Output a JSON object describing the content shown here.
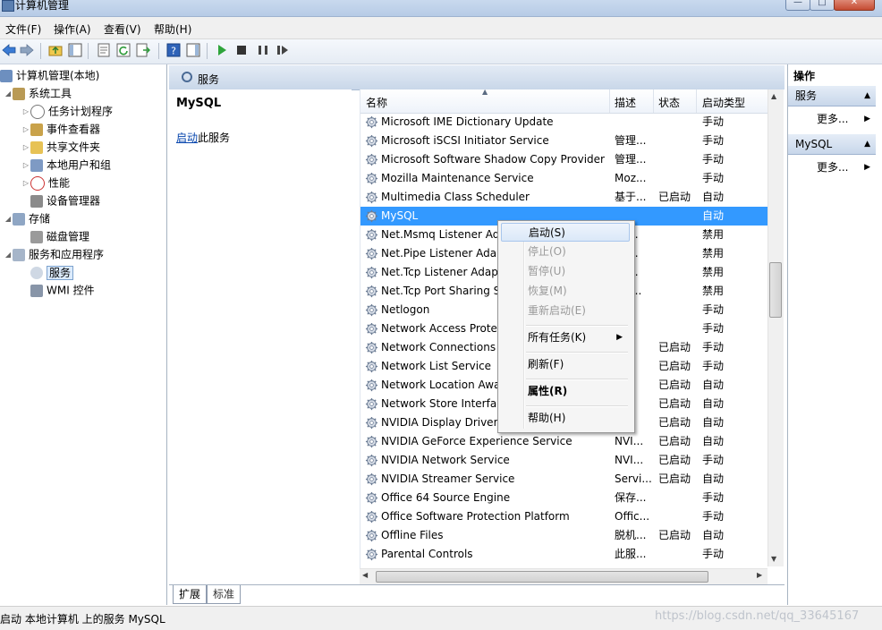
{
  "window": {
    "title": "计算机管理"
  },
  "menu": {
    "items": [
      "文件(F)",
      "操作(A)",
      "查看(V)",
      "帮助(H)"
    ]
  },
  "tree": {
    "root": "计算机管理(本地)",
    "system_tools": "系统工具",
    "task_scheduler": "任务计划程序",
    "event_viewer": "事件查看器",
    "shared_folders": "共享文件夹",
    "local_users": "本地用户和组",
    "performance": "性能",
    "device_manager": "设备管理器",
    "storage": "存储",
    "disk_management": "磁盘管理",
    "services_apps": "服务和应用程序",
    "services": "服务",
    "wmi": "WMI 控件"
  },
  "center": {
    "header_title": "服务",
    "selected_service": "MySQL",
    "start_link": "启动",
    "start_suffix": "此服务"
  },
  "columns": {
    "name": "名称",
    "desc": "描述",
    "status": "状态",
    "startup": "启动类型"
  },
  "services": [
    {
      "name": "Microsoft IME Dictionary Update",
      "desc": "",
      "status": "",
      "startup": "手动"
    },
    {
      "name": "Microsoft iSCSI Initiator Service",
      "desc": "管理...",
      "status": "",
      "startup": "手动"
    },
    {
      "name": "Microsoft Software Shadow Copy Provider",
      "desc": "管理...",
      "status": "",
      "startup": "手动"
    },
    {
      "name": "Mozilla Maintenance Service",
      "desc": "Moz...",
      "status": "",
      "startup": "手动"
    },
    {
      "name": "Multimedia Class Scheduler",
      "desc": "基于...",
      "status": "已启动",
      "startup": "自动"
    },
    {
      "name": "MySQL",
      "desc": "",
      "status": "",
      "startup": "自动"
    },
    {
      "name": "Net.Msmq Listener Adapter",
      "desc": "Re...",
      "status": "",
      "startup": "禁用"
    },
    {
      "name": "Net.Pipe Listener Adapter",
      "desc": "Re...",
      "status": "",
      "startup": "禁用"
    },
    {
      "name": "Net.Tcp Listener Adapter",
      "desc": "Re...",
      "status": "",
      "startup": "禁用"
    },
    {
      "name": "Net.Tcp Port Sharing Service",
      "desc": "Pro...",
      "status": "",
      "startup": "禁用"
    },
    {
      "name": "Netlogon",
      "desc": "",
      "status": "",
      "startup": "手动"
    },
    {
      "name": "Network Access Protection Agent",
      "desc": "",
      "status": "",
      "startup": "手动"
    },
    {
      "name": "Network Connections",
      "desc": "",
      "status": "已启动",
      "startup": "手动"
    },
    {
      "name": "Network List Service",
      "desc": "",
      "status": "已启动",
      "startup": "手动"
    },
    {
      "name": "Network Location Awareness",
      "desc": "",
      "status": "已启动",
      "startup": "自动"
    },
    {
      "name": "Network Store Interface Service",
      "desc": "",
      "status": "已启动",
      "startup": "自动"
    },
    {
      "name": "NVIDIA Display Driver Service",
      "desc": "",
      "status": "已启动",
      "startup": "自动"
    },
    {
      "name": "NVIDIA GeForce Experience Service",
      "desc": "NVI...",
      "status": "已启动",
      "startup": "自动"
    },
    {
      "name": "NVIDIA Network Service",
      "desc": "NVI...",
      "status": "已启动",
      "startup": "手动"
    },
    {
      "name": "NVIDIA Streamer Service",
      "desc": "Servi...",
      "status": "已启动",
      "startup": "自动"
    },
    {
      "name": "Office 64 Source Engine",
      "desc": "保存...",
      "status": "",
      "startup": "手动"
    },
    {
      "name": "Office Software Protection Platform",
      "desc": "Offic...",
      "status": "",
      "startup": "手动"
    },
    {
      "name": "Offline Files",
      "desc": "脱机...",
      "status": "已启动",
      "startup": "自动"
    },
    {
      "name": "Parental Controls",
      "desc": "此服...",
      "status": "",
      "startup": "手动"
    }
  ],
  "context_menu": {
    "start": "启动(S)",
    "stop": "停止(O)",
    "pause": "暂停(U)",
    "resume": "恢复(M)",
    "restart": "重新启动(E)",
    "all_tasks": "所有任务(K)",
    "refresh": "刷新(F)",
    "properties": "属性(R)",
    "help": "帮助(H)"
  },
  "tabs": {
    "extended": "扩展",
    "standard": "标准"
  },
  "actions": {
    "title": "操作",
    "group1": "服务",
    "more1": "更多...",
    "group2": "MySQL",
    "more2": "更多..."
  },
  "status": {
    "text": "启动 本地计算机 上的服务 MySQL"
  },
  "watermark": "https://blog.csdn.net/qq_33645167",
  "colors": {
    "selection": "#3399ff",
    "header": "#c9d7e9"
  }
}
